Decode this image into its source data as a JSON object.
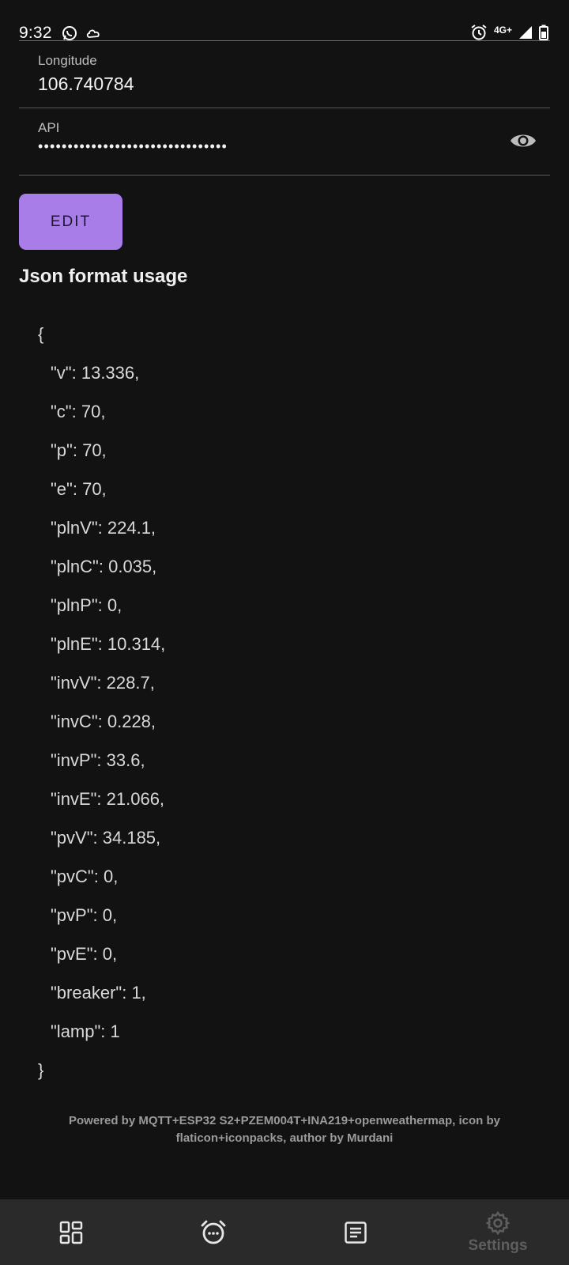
{
  "status_bar": {
    "time": "9:32",
    "network": "4G+",
    "left_icons": [
      "whatsapp-icon",
      "cloud-icon"
    ],
    "right_icons": [
      "alarm-icon",
      "signal-icon",
      "battery-icon"
    ]
  },
  "fields": {
    "longitude": {
      "label": "Longitude",
      "value": "106.740784"
    },
    "api": {
      "label": "API",
      "value": "••••••••••••••••••••••••••••••••",
      "toggle_icon": "eye-icon"
    }
  },
  "edit_button": {
    "label": "EDIT"
  },
  "json_section": {
    "title": "Json format usage",
    "open_brace": "{",
    "close_brace": "}",
    "lines": [
      "\"v\": 13.336,",
      "\"c\": 70,",
      "\"p\": 70,",
      "\"e\": 70,",
      "\"plnV\": 224.1,",
      "\"plnC\": 0.035,",
      "\"plnP\": 0,",
      "\"plnE\": 10.314,",
      "\"invV\": 228.7,",
      "\"invC\": 0.228,",
      "\"invP\": 33.6,",
      "\"invE\": 21.066,",
      "\"pvV\": 34.185,",
      "\"pvC\": 0,",
      "\"pvP\": 0,",
      "\"pvE\": 0,",
      "\"breaker\": 1,",
      "\"lamp\": 1"
    ]
  },
  "footer": {
    "text": "Powered by MQTT+ESP32 S2+PZEM004T+INA219+openweathermap, icon by flaticon+iconpacks, author by Murdani"
  },
  "bottom_nav": {
    "items": [
      {
        "icon": "dashboard-icon",
        "label": ""
      },
      {
        "icon": "alarm-icon",
        "label": ""
      },
      {
        "icon": "notes-icon",
        "label": ""
      },
      {
        "icon": "gear-icon",
        "label": "Settings"
      }
    ]
  },
  "colors": {
    "background": "#121212",
    "accent": "#a97de8",
    "nav_background": "#2a2a2a"
  }
}
